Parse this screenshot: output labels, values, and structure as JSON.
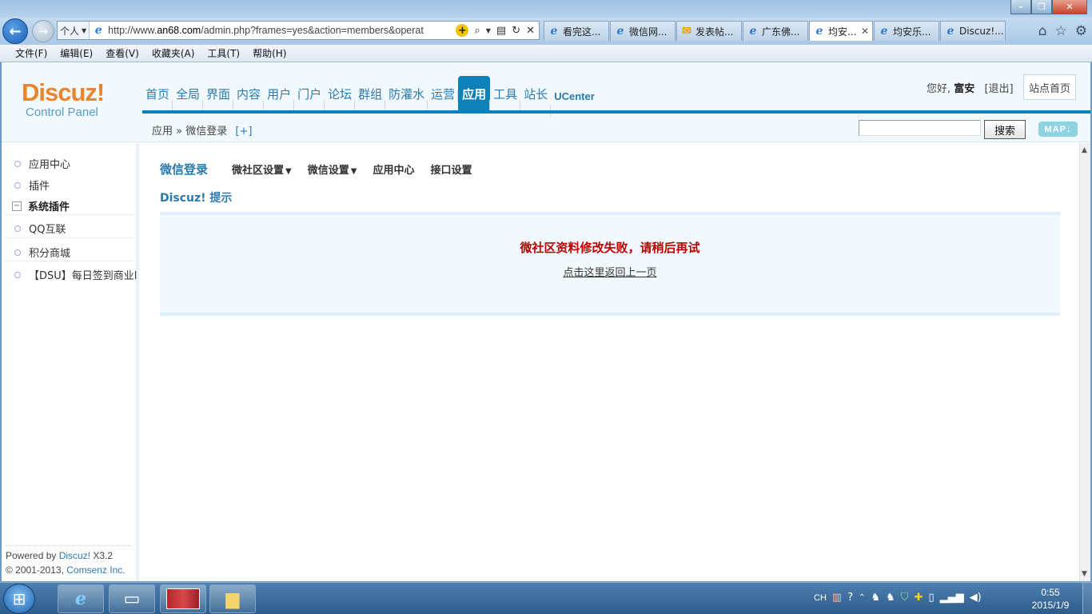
{
  "browser": {
    "address": {
      "zone": "个人",
      "url_prefix": "http://www.",
      "url_domain": "an68.com",
      "url_rest": "/admin.php?frames=yes&action=members&operat"
    },
    "tabs": [
      {
        "label": "看完这..."
      },
      {
        "label": "微信网..."
      },
      {
        "label": "发表帖..."
      },
      {
        "label": "广东佛..."
      },
      {
        "label": "均安..."
      },
      {
        "label": "均安乐..."
      },
      {
        "label": "Discuz!..."
      }
    ],
    "menu": [
      "文件(F)",
      "编辑(E)",
      "查看(V)",
      "收藏夹(A)",
      "工具(T)",
      "帮助(H)"
    ]
  },
  "header": {
    "logo_main": "Discuz!",
    "logo_sub": "Control Panel",
    "nav": [
      "首页",
      "全局",
      "界面",
      "内容",
      "用户",
      "门户",
      "论坛",
      "群组",
      "防灌水",
      "运营",
      "应用",
      "工具",
      "站长",
      "UCenter"
    ],
    "greeting": "您好,",
    "username": "富安",
    "logout": "[退出]",
    "site_home": "站点首页",
    "breadcrumb_root": "应用",
    "breadcrumb_sep": "»",
    "breadcrumb_current": "微信登录",
    "breadcrumb_add": "[+]",
    "search_button": "搜索",
    "map_button": "MAP"
  },
  "sidebar": {
    "item_app_center": "应用中心",
    "item_plugins": "插件",
    "group_label": "系统插件",
    "item_qq": "QQ互联",
    "item_shop": "积分商城",
    "item_dsu": "【DSU】每日签到商业l",
    "footer_powered": "Powered by",
    "footer_product": "Discuz!",
    "footer_version": "X3.2",
    "footer_copyright": "© 2001-2013,",
    "footer_company": "Comsenz Inc."
  },
  "content": {
    "title": "微信登录",
    "sub_nav": [
      "微社区设置",
      "微信设置",
      "应用中心",
      "接口设置"
    ],
    "notice_title": "Discuz! 提示",
    "error_message": "微社区资料修改失败，请稍后再试",
    "back_link": "点击这里返回上一页"
  },
  "taskbar": {
    "lang": "CH",
    "time": "0:55",
    "date": "2015/1/9"
  }
}
